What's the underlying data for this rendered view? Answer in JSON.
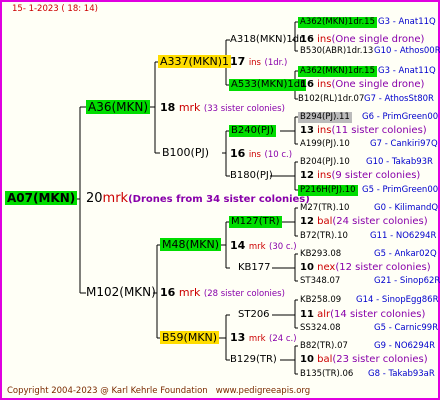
{
  "header": {
    "date": "15-   1-2023 (  18:  14)"
  },
  "root": {
    "name": "A07(MKN)",
    "year": "20",
    "mark": "mrk",
    "note": "(Drones from 34 sister colonies)"
  },
  "gen1": [
    {
      "name": "A36(MKN)",
      "year": "18",
      "mark": "mrk",
      "note": "(33 sister colonies)"
    },
    {
      "name": "M102(MKN)",
      "year": "16",
      "mark": "mrk",
      "note": "(28 sister colonies)"
    }
  ],
  "gen2": [
    {
      "name": "A337(MKN)1",
      "year": "17",
      "mark": "ins",
      "note": "(1dr.)"
    },
    {
      "name": "B100(PJ)",
      "year": "16",
      "mark": "ins",
      "note": "(10 c.)"
    },
    {
      "name": "M48(MKN)",
      "year": "14",
      "mark": "mrk",
      "note": "(30 c.)"
    },
    {
      "name": "B59(MKN)",
      "year": "13",
      "mark": "mrk",
      "note": "(24 c.)"
    }
  ],
  "gen3": [
    {
      "name": "A318(MKN)1dr",
      "year": "",
      "mark": "",
      "note": ""
    },
    {
      "name": "A533(MKN)1dr",
      "year": "16",
      "mark": "ins",
      "note": "(One single drone)"
    },
    {
      "name": "B240(PJ)",
      "year": "13",
      "mark": "ins",
      "note": "(11 sister colonies)"
    },
    {
      "name": "B180(PJ)",
      "year": "12",
      "mark": "ins",
      "note": "(9 sister colonies)"
    },
    {
      "name": "M127(TR)",
      "year": "12",
      "mark": "bal",
      "note": "(24 sister colonies)"
    },
    {
      "name": "KB177",
      "year": "10",
      "mark": "nex",
      "note": "(12 sister colonies)"
    },
    {
      "name": "ST206",
      "year": "11",
      "mark": "alr",
      "note": "(14 sister colonies)"
    },
    {
      "name": "B129(TR)",
      "year": "10",
      "mark": "bal",
      "note": "(23 sister colonies)"
    }
  ],
  "gen4": [
    {
      "name": "A362(MKN)1dr.15",
      "right": "G3 - Anat11Q"
    },
    {
      "name": "B530(ABR)1dr.13",
      "right": "G10 - Athos00R"
    },
    {
      "name": "A362(MKN)1dr.15",
      "right": "G3 - Anat11Q"
    },
    {
      "name": "B102(RL)1dr.07",
      "right": "G7 - AthosSt80R"
    },
    {
      "name": "B294(PJ).11",
      "right": "G6 - PrimGreen00"
    },
    {
      "name": "A199(PJ).10",
      "right": "G7 - Cankiri97Q"
    },
    {
      "name": "B204(PJ).10",
      "right": "G10 - Takab93R"
    },
    {
      "name": "P216H(PJ).10",
      "right": "G5 - PrimGreen00"
    },
    {
      "name": "M27(TR).10",
      "right": "G0 - KilimandQ"
    },
    {
      "name": "B72(TR).10",
      "right": "G11 - NO6294R"
    },
    {
      "name": "KB293.08",
      "right": "G5 - Ankar02Q"
    },
    {
      "name": "ST348.07",
      "right": "G21 - Sinop62R"
    },
    {
      "name": "KB258.09",
      "right": "G14 - SinopEgg86R"
    },
    {
      "name": "SS324.08",
      "right": "G5 - Carnic99R"
    },
    {
      "name": "B82(TR).07",
      "right": "G9 - NO6294R"
    },
    {
      "name": "B135(TR).06",
      "right": "G8 - Takab93aR"
    }
  ],
  "gen3_subnotes": {
    "a318": {
      "year": "17",
      "mark": "ins",
      "note": ""
    },
    "a318_year": "16",
    "a318_mark": "ins",
    "a318_note": "(One single drone)"
  },
  "footer": {
    "copyright": "Copyright 2004-2023 @ Karl Kehrle Foundation",
    "site": "www.pedigreeapis.org"
  },
  "colors": {
    "border": "#e000e0",
    "green": "#00dd00",
    "yellow": "#ffdd00",
    "gray": "#bbbbbb"
  }
}
